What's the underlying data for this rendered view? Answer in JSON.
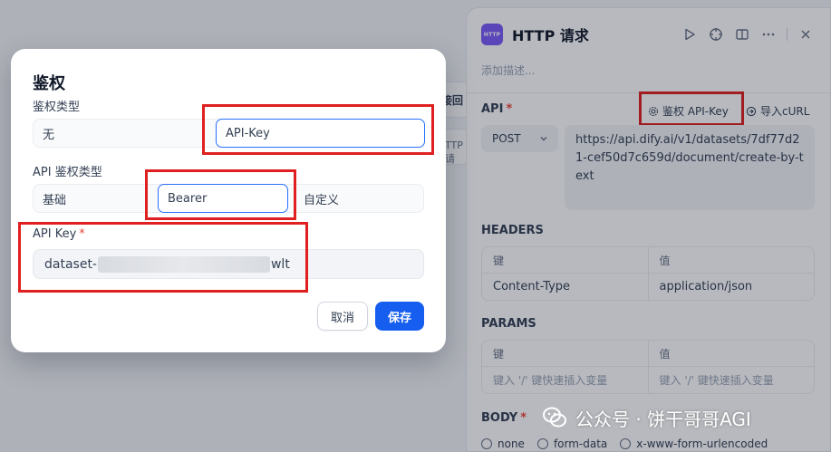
{
  "panel": {
    "badge": "HTTP",
    "title": "HTTP 请求",
    "desc_placeholder": "添加描述...",
    "api_label": "API",
    "required_mark": "*",
    "auth_link": "鉴权 API-Key",
    "curl_link": "导入cURL",
    "method": "POST",
    "url": "https://api.dify.ai/v1/datasets/7df77d21-cef50d7c659d/document/create-by-text",
    "headers_label": "HEADERS",
    "headers": {
      "key_header": "键",
      "value_header": "值",
      "rows": [
        {
          "key": "Content-Type",
          "value": "application/json"
        }
      ]
    },
    "params_label": "PARAMS",
    "params": {
      "key_header": "键",
      "value_header": "值",
      "key_placeholder": "键入 '/' 键快速插入变量",
      "value_placeholder": "键入 '/' 键快速插入变量"
    },
    "body_label": "BODY",
    "body_options": [
      "none",
      "form-data",
      "x-www-form-urlencoded"
    ]
  },
  "canvas": {
    "node_fragment_1": "接回",
    "node_fragment_2": "TTP 请"
  },
  "modal": {
    "title": "鉴权",
    "auth_type_label": "鉴权类型",
    "auth_types": [
      "无",
      "API-Key"
    ],
    "selected_auth_type": "API-Key",
    "api_auth_type_label": "API 鉴权类型",
    "api_auth_types": [
      "基础",
      "Bearer",
      "自定义"
    ],
    "selected_api_auth_type": "Bearer",
    "api_key_label": "API Key",
    "required_mark": "*",
    "api_key_prefix": "dataset-",
    "api_key_suffix": "wlt",
    "cancel": "取消",
    "save": "保存"
  },
  "watermark": "公众号 · 饼干哥哥AGI",
  "colors": {
    "accent": "#155eef",
    "highlight": "#e02020",
    "badge": "#7a5af8"
  }
}
